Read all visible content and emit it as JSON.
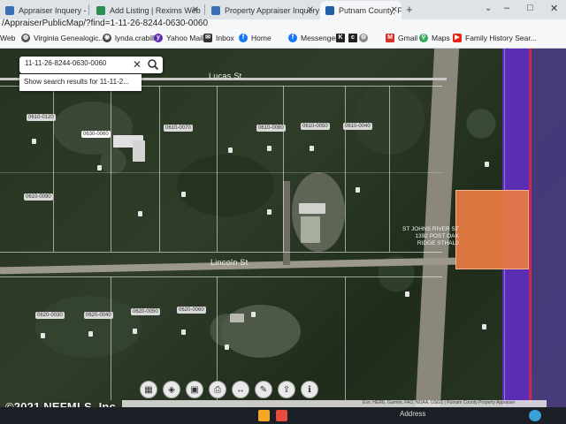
{
  "browser": {
    "tabs": [
      {
        "label": "Appraiser Inquery - Pu",
        "active": false
      },
      {
        "label": "Add Listing | Rexims Web",
        "active": false
      },
      {
        "label": "Property Appraiser Inquery - Putn",
        "active": false
      },
      {
        "label": "Putnam County, FL",
        "active": true
      }
    ],
    "url": "/AppraiserPublicMap/?find=1-11-26-8244-0630-0060",
    "bookmarks": [
      {
        "label": "Web",
        "icon": "web-icon"
      },
      {
        "label": "Virginia Genealogic...",
        "icon": "globe-icon"
      },
      {
        "label": "lynda.crabill",
        "icon": "chrome-icon"
      },
      {
        "label": "Yahoo Mail",
        "icon": "yahoo-icon"
      },
      {
        "label": "Inbox",
        "icon": "mail-icon"
      },
      {
        "label": "Home",
        "icon": "facebook-icon"
      },
      {
        "label": "Messenger",
        "icon": "facebook-icon"
      },
      {
        "label": "Gmail",
        "icon": "gmail-icon"
      },
      {
        "label": "Maps",
        "icon": "maps-icon"
      },
      {
        "label": "Family History Sear...",
        "icon": "youtube-icon"
      }
    ]
  },
  "map": {
    "search": {
      "value": "11-11-26-8244-0630-0060",
      "result_text": "Show search results for 11-11-2..."
    },
    "streets": {
      "lucas": "Lucas St",
      "lincoln": "Lincoln St"
    },
    "selected_parcel": {
      "owner_label_lines": [
        "ST JOHNS RIVER ST",
        "1392 POST OAK",
        "RIDGE STHAL0"
      ],
      "fill_color": "#eb7c42"
    },
    "parcel_labels": [
      "0630-0060",
      "0610-0120",
      "0610-0070",
      "0610-0080",
      "0610-0050",
      "0610-0040",
      "0620-0030",
      "0620-0040",
      "0620-0050",
      "0620-0060",
      "0610-0090"
    ],
    "toolbar_icons": [
      "grid-icon",
      "layers-icon",
      "basemap-icon",
      "print-icon",
      "measure-icon",
      "draw-icon",
      "share-icon",
      "info-icon"
    ],
    "attribution": "Esri, HERE, Garmin, FAO, NOAA, USGS | Putnam County Property Appraiser"
  },
  "watermark": "©2021 NEFMLS, Inc.",
  "taskbar": {
    "address_label": "Address"
  },
  "colors": {
    "waterway": "#5a2db4",
    "parcel_highlight": "#eb7c42"
  }
}
